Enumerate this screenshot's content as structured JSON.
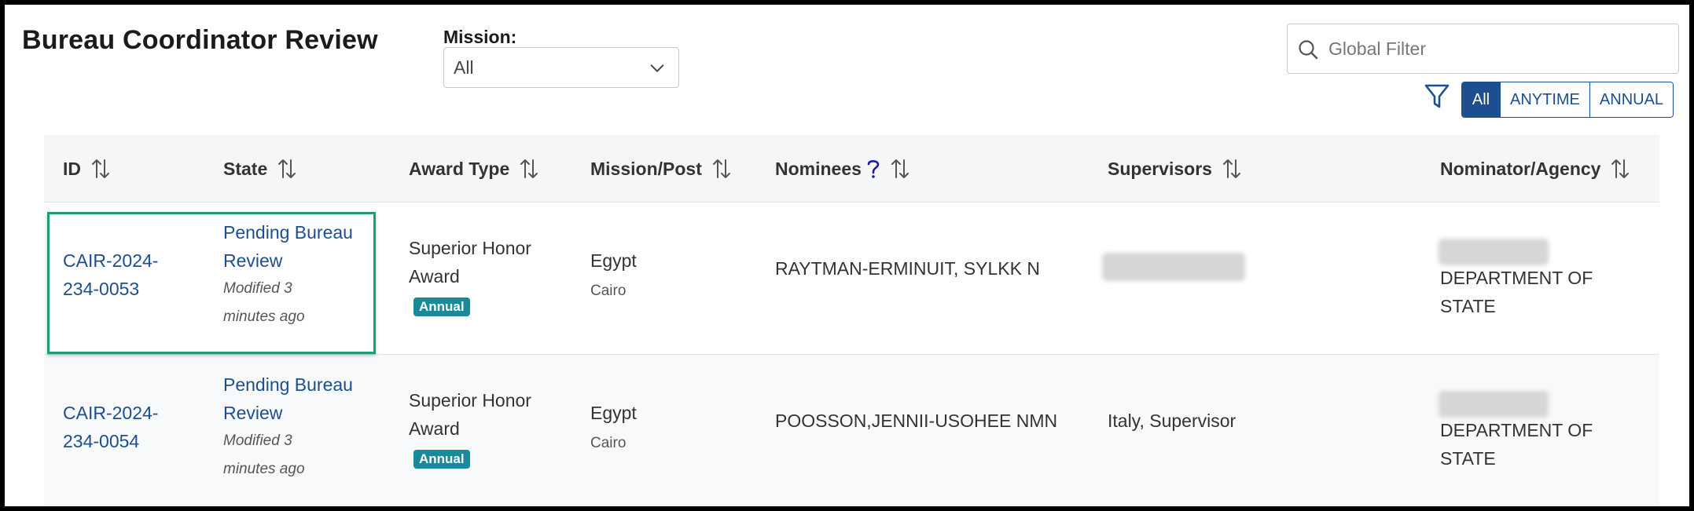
{
  "page": {
    "title": "Bureau Coordinator Review"
  },
  "mission_filter": {
    "label": "Mission:",
    "selected": "All"
  },
  "global_filter": {
    "placeholder": "Global Filter"
  },
  "type_toggle": {
    "options": [
      "All",
      "ANYTIME",
      "ANNUAL"
    ],
    "active": "All"
  },
  "colors": {
    "accent": "#1d4e8f",
    "badge": "#1a8a9a",
    "highlight": "#1f9d79"
  },
  "table": {
    "headers": {
      "id": "ID",
      "state": "State",
      "award_type": "Award Type",
      "mission_post": "Mission/Post",
      "nominees": "Nominees",
      "supervisors": "Supervisors",
      "nominator_agency": "Nominator/Agency"
    },
    "rows": [
      {
        "id_line1": "CAIR-2024-",
        "id_line2": "234-0053",
        "state_line1": "Pending Bureau",
        "state_line2": "Review",
        "modified_line1": "Modified 3",
        "modified_line2": "minutes ago",
        "award_line1": "Superior Honor",
        "award_line2": "Award",
        "badge": "Annual",
        "mission": "Egypt",
        "post": "Cairo",
        "nominee": "RAYTMAN-ERMINUIT, SYLKK N",
        "supervisor": "",
        "agency_line1": "DEPARTMENT OF",
        "agency_line2": "STATE"
      },
      {
        "id_line1": "CAIR-2024-",
        "id_line2": "234-0054",
        "state_line1": "Pending Bureau",
        "state_line2": "Review",
        "modified_line1": "Modified 3",
        "modified_line2": "minutes ago",
        "award_line1": "Superior Honor",
        "award_line2": "Award",
        "badge": "Annual",
        "mission": "Egypt",
        "post": "Cairo",
        "nominee": "POOSSON,JENNII-USOHEE NMN",
        "supervisor": "Italy, Supervisor",
        "agency_line1": "DEPARTMENT OF",
        "agency_line2": "STATE"
      }
    ]
  }
}
